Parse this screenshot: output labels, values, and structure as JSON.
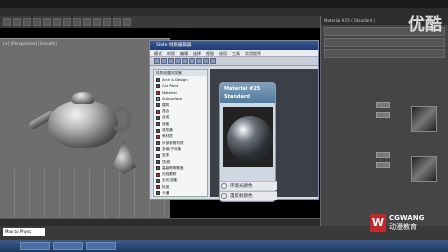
{
  "watermark": {
    "site": "优酷",
    "brand_en": "CGWANG",
    "brand_cn": "动漫教育"
  },
  "max": {
    "viewport_label": "[+] [Perspective] [Smooth]",
    "status_field": "Max to Physc"
  },
  "material_editor": {
    "title": "Slate 材质编辑器",
    "menu": [
      "模式",
      "材质",
      "编辑",
      "选择",
      "视图",
      "选项",
      "工具",
      "实用程序"
    ],
    "browser_header": "材质/贴图浏览器",
    "list_items": [
      "Arch & Design",
      "Car Paint",
      "Material",
      "Subsurface",
      "建筑",
      "混合",
      "合成",
      "双面",
      "变形器",
      "壳材质",
      "外部参照材质",
      "多维/子对象",
      "虫漆",
      "顶/底",
      "高级照明覆盖",
      "光线跟踪",
      "无光/投影",
      "标准",
      "卡通"
    ],
    "node": {
      "name": "Material #25",
      "type": "Standard",
      "slots": [
        "环境光颜色",
        "漫反射颜色"
      ]
    }
  },
  "command_panel": {
    "header": "Material #25 ( Standard )"
  },
  "colors": {
    "max_bg": "#3a3a3a",
    "viewport": "#6e6e6e",
    "node_header": "#557a9b",
    "title_bar": "#1f3a72",
    "brand_red": "#c0282d"
  }
}
